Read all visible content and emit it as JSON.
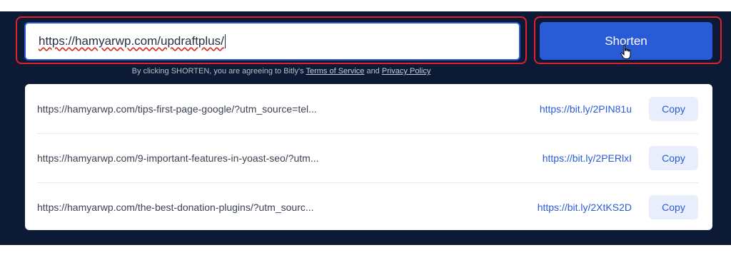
{
  "shortener": {
    "url_value": "https://hamyarwp.com/updraftplus/",
    "button_label": "Shorten",
    "terms_prefix": "By clicking SHORTEN, you are agreeing to Bitly's ",
    "terms_link": "Terms of Service",
    "terms_and": " and ",
    "privacy_link": "Privacy Policy"
  },
  "links": [
    {
      "long": "https://hamyarwp.com/tips-first-page-google/?utm_source=tel...",
      "short": "https://bit.ly/2PIN81u",
      "copy": "Copy"
    },
    {
      "long": "https://hamyarwp.com/9-important-features-in-yoast-seo/?utm...",
      "short": "https://bit.ly/2PERlxI",
      "copy": "Copy"
    },
    {
      "long": "https://hamyarwp.com/the-best-donation-plugins/?utm_sourc...",
      "short": "https://bit.ly/2XtKS2D",
      "copy": "Copy"
    }
  ],
  "colors": {
    "panel_bg": "#0d1a35",
    "accent": "#2a5bd7",
    "highlight": "#e0202a"
  }
}
